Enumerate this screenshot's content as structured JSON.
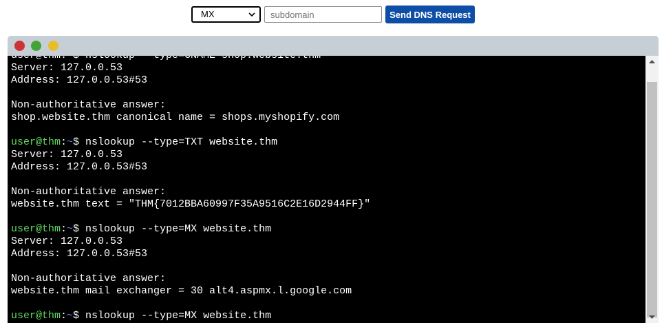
{
  "controls": {
    "record_type": "MX",
    "subdomain_placeholder": "subdomain",
    "subdomain_value": "",
    "send_label": "Send DNS Request"
  },
  "terminal": {
    "lines": [
      {
        "text": "user@thm:~$ nslookup --type=CNAME shop.website.thm"
      },
      {
        "text": "Server: 127.0.0.53"
      },
      {
        "text": "Address: 127.0.0.53#53"
      },
      {
        "text": ""
      },
      {
        "text": "Non-authoritative answer:"
      },
      {
        "text": "shop.website.thm canonical name = shops.myshopify.com"
      },
      {
        "text": ""
      },
      {
        "user": "user@thm",
        "path": "~",
        "text": "$ nslookup --type=TXT website.thm"
      },
      {
        "text": "Server: 127.0.0.53"
      },
      {
        "text": "Address: 127.0.0.53#53"
      },
      {
        "text": ""
      },
      {
        "text": "Non-authoritative answer:"
      },
      {
        "text": "website.thm text = \"THM{7012BBA60997F35A9516C2E16D2944FF}\""
      },
      {
        "text": ""
      },
      {
        "user": "user@thm",
        "path": "~",
        "text": "$ nslookup --type=MX website.thm"
      },
      {
        "text": "Server: 127.0.0.53"
      },
      {
        "text": "Address: 127.0.0.53#53"
      },
      {
        "text": ""
      },
      {
        "text": "Non-authoritative answer:"
      },
      {
        "text": "website.thm mail exchanger = 30 alt4.aspmx.l.google.com"
      },
      {
        "text": ""
      },
      {
        "user": "user@thm",
        "path": "~",
        "text": "$ nslookup --type=MX website.thm"
      }
    ]
  },
  "colors": {
    "button": "#0e4ea6",
    "window_frame": "#c6ced6",
    "terminal_bg": "#000000",
    "terminal_text": "#ffffff",
    "prompt_user": "#5fd75f",
    "prompt_path": "#5f87ff",
    "dot_close": "#cc3333",
    "dot_maximize": "#44a337",
    "dot_minimize": "#e8bd2c"
  },
  "icons": {
    "select": "chevron-down-icon",
    "scroll_up": "arrow-up-icon",
    "scroll_down": "arrow-down-icon"
  }
}
